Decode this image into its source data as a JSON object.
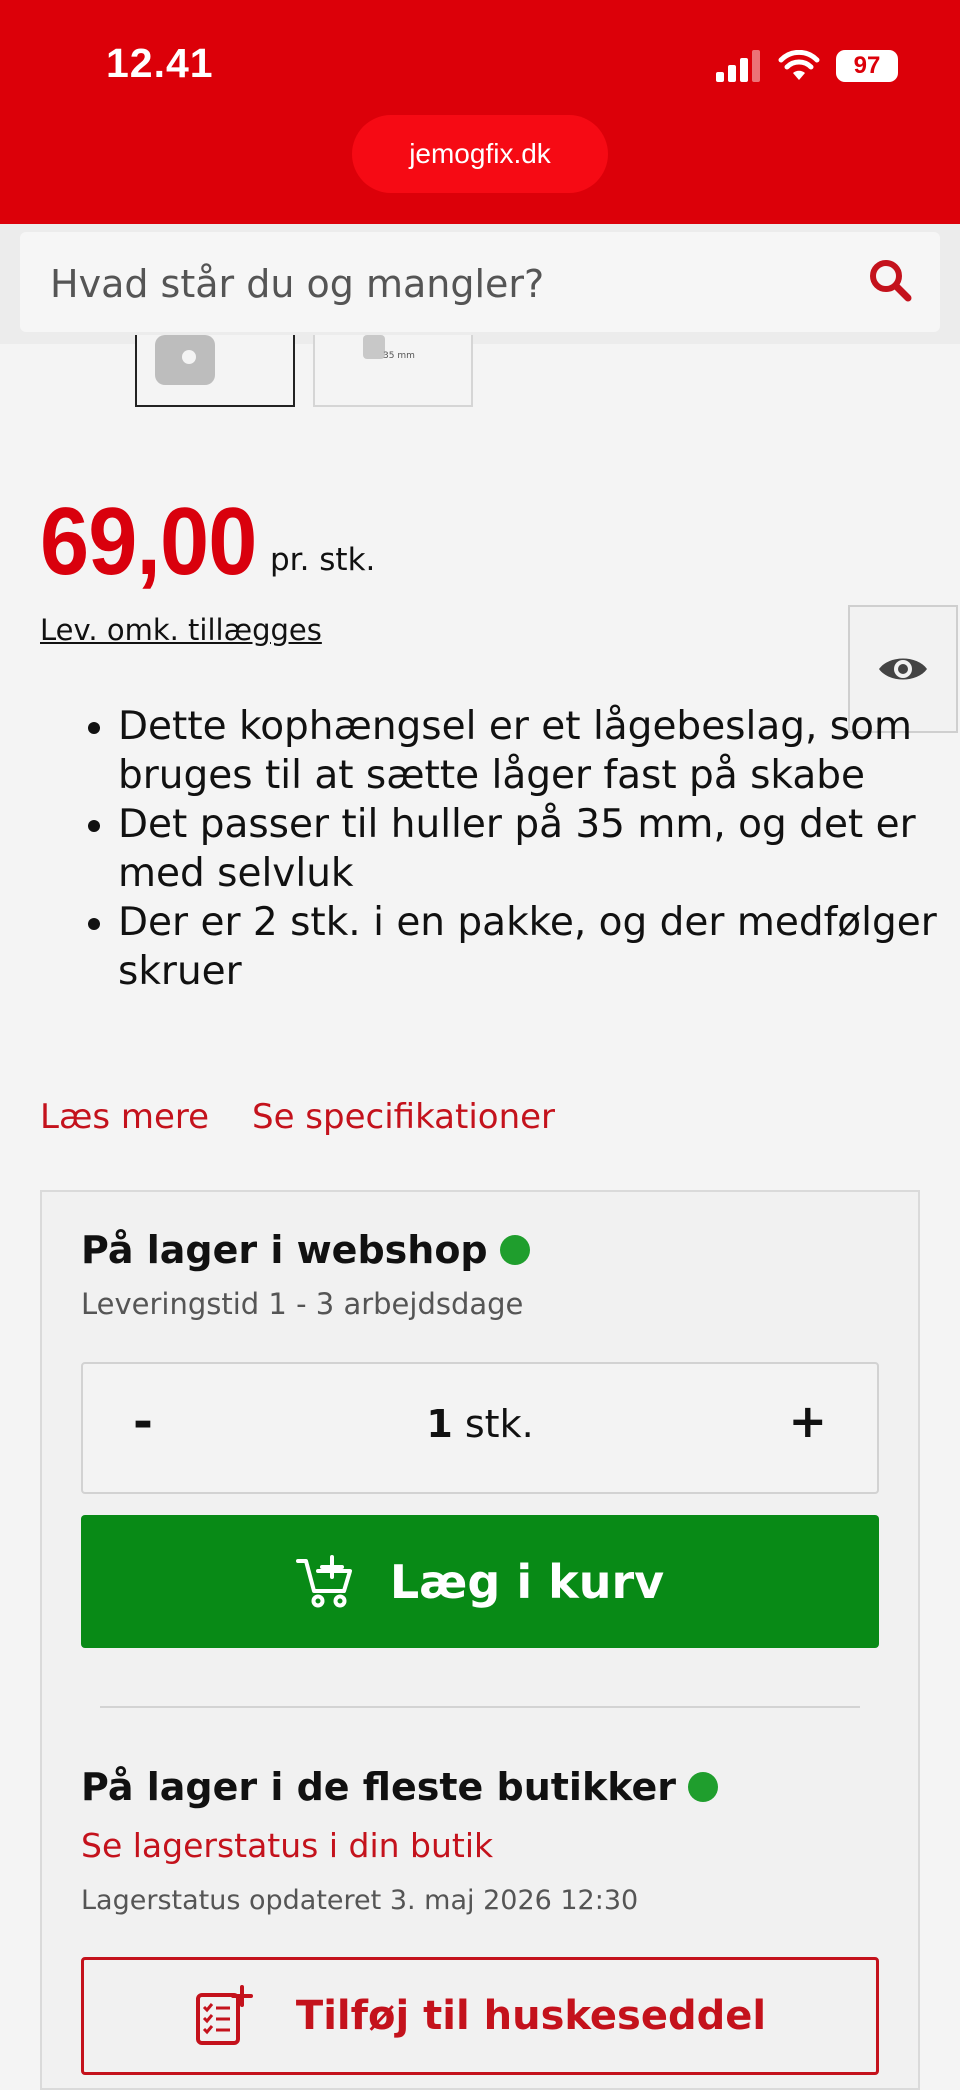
{
  "status_bar": {
    "time": "12.41",
    "battery": "97"
  },
  "browser": {
    "url": "jemogfix.dk"
  },
  "search": {
    "placeholder": "Hvad står du og mangler?"
  },
  "product": {
    "price": "69,00",
    "price_unit": "pr. stk.",
    "delivery_note": "Lev. omk. tillægges",
    "features": [
      "Dette kophængsel er et lågebeslag, som bruges til at sætte låger fast på skabe",
      "Det passer til huller på 35 mm, og det er med selvluk",
      "Der er 2 stk. i en pakke, og der medfølger skruer"
    ],
    "read_more": "Læs mere",
    "see_specs": "Se specifikationer",
    "thumb_caption": "35 mm"
  },
  "webshop_stock": {
    "title": "På lager i webshop",
    "delivery_time": "Leveringstid 1 - 3 arbejdsdage",
    "status_color": "#1f9e2d"
  },
  "quantity": {
    "minus": "-",
    "value": "1",
    "unit": "stk.",
    "plus": "+"
  },
  "cart_button": {
    "label": "Læg i kurv",
    "color": "#088a16"
  },
  "store_stock": {
    "title": "På lager i de fleste butikker",
    "link": "Se lagerstatus i din butik",
    "updated": "Lagerstatus opdateret 3. maj 2026 12:30"
  },
  "shopping_list_button": {
    "label": "Tilføj til huskeseddel"
  },
  "colors": {
    "brand_red": "#dc0009",
    "link_red": "#c4121c"
  },
  "icons": [
    "signal-icon",
    "wifi-icon",
    "battery-icon",
    "search-icon",
    "eye-icon",
    "cart-add-icon",
    "checklist-add-icon"
  ]
}
